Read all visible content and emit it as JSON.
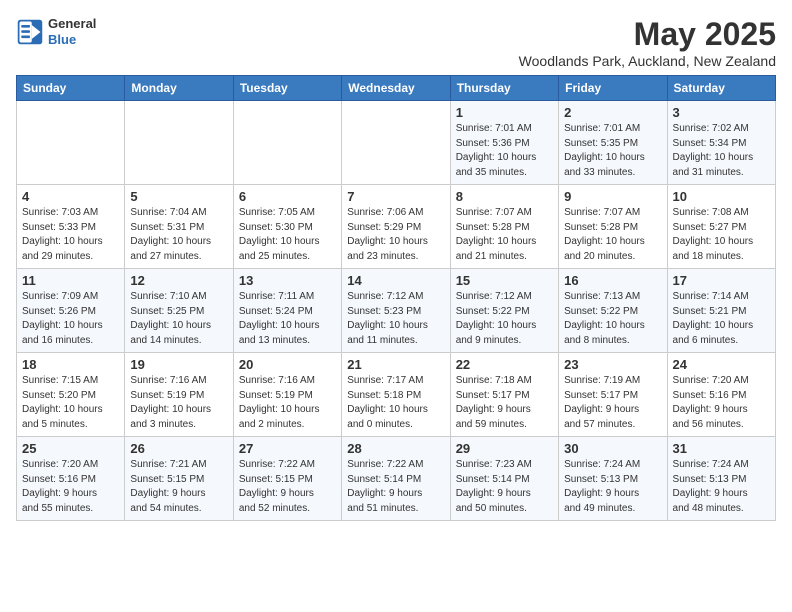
{
  "logo": {
    "line1": "General",
    "line2": "Blue"
  },
  "title": "May 2025",
  "subtitle": "Woodlands Park, Auckland, New Zealand",
  "days_of_week": [
    "Sunday",
    "Monday",
    "Tuesday",
    "Wednesday",
    "Thursday",
    "Friday",
    "Saturday"
  ],
  "weeks": [
    [
      {
        "num": "",
        "info": ""
      },
      {
        "num": "",
        "info": ""
      },
      {
        "num": "",
        "info": ""
      },
      {
        "num": "",
        "info": ""
      },
      {
        "num": "1",
        "info": "Sunrise: 7:01 AM\nSunset: 5:36 PM\nDaylight: 10 hours\nand 35 minutes."
      },
      {
        "num": "2",
        "info": "Sunrise: 7:01 AM\nSunset: 5:35 PM\nDaylight: 10 hours\nand 33 minutes."
      },
      {
        "num": "3",
        "info": "Sunrise: 7:02 AM\nSunset: 5:34 PM\nDaylight: 10 hours\nand 31 minutes."
      }
    ],
    [
      {
        "num": "4",
        "info": "Sunrise: 7:03 AM\nSunset: 5:33 PM\nDaylight: 10 hours\nand 29 minutes."
      },
      {
        "num": "5",
        "info": "Sunrise: 7:04 AM\nSunset: 5:31 PM\nDaylight: 10 hours\nand 27 minutes."
      },
      {
        "num": "6",
        "info": "Sunrise: 7:05 AM\nSunset: 5:30 PM\nDaylight: 10 hours\nand 25 minutes."
      },
      {
        "num": "7",
        "info": "Sunrise: 7:06 AM\nSunset: 5:29 PM\nDaylight: 10 hours\nand 23 minutes."
      },
      {
        "num": "8",
        "info": "Sunrise: 7:07 AM\nSunset: 5:28 PM\nDaylight: 10 hours\nand 21 minutes."
      },
      {
        "num": "9",
        "info": "Sunrise: 7:07 AM\nSunset: 5:28 PM\nDaylight: 10 hours\nand 20 minutes."
      },
      {
        "num": "10",
        "info": "Sunrise: 7:08 AM\nSunset: 5:27 PM\nDaylight: 10 hours\nand 18 minutes."
      }
    ],
    [
      {
        "num": "11",
        "info": "Sunrise: 7:09 AM\nSunset: 5:26 PM\nDaylight: 10 hours\nand 16 minutes."
      },
      {
        "num": "12",
        "info": "Sunrise: 7:10 AM\nSunset: 5:25 PM\nDaylight: 10 hours\nand 14 minutes."
      },
      {
        "num": "13",
        "info": "Sunrise: 7:11 AM\nSunset: 5:24 PM\nDaylight: 10 hours\nand 13 minutes."
      },
      {
        "num": "14",
        "info": "Sunrise: 7:12 AM\nSunset: 5:23 PM\nDaylight: 10 hours\nand 11 minutes."
      },
      {
        "num": "15",
        "info": "Sunrise: 7:12 AM\nSunset: 5:22 PM\nDaylight: 10 hours\nand 9 minutes."
      },
      {
        "num": "16",
        "info": "Sunrise: 7:13 AM\nSunset: 5:22 PM\nDaylight: 10 hours\nand 8 minutes."
      },
      {
        "num": "17",
        "info": "Sunrise: 7:14 AM\nSunset: 5:21 PM\nDaylight: 10 hours\nand 6 minutes."
      }
    ],
    [
      {
        "num": "18",
        "info": "Sunrise: 7:15 AM\nSunset: 5:20 PM\nDaylight: 10 hours\nand 5 minutes."
      },
      {
        "num": "19",
        "info": "Sunrise: 7:16 AM\nSunset: 5:19 PM\nDaylight: 10 hours\nand 3 minutes."
      },
      {
        "num": "20",
        "info": "Sunrise: 7:16 AM\nSunset: 5:19 PM\nDaylight: 10 hours\nand 2 minutes."
      },
      {
        "num": "21",
        "info": "Sunrise: 7:17 AM\nSunset: 5:18 PM\nDaylight: 10 hours\nand 0 minutes."
      },
      {
        "num": "22",
        "info": "Sunrise: 7:18 AM\nSunset: 5:17 PM\nDaylight: 9 hours\nand 59 minutes."
      },
      {
        "num": "23",
        "info": "Sunrise: 7:19 AM\nSunset: 5:17 PM\nDaylight: 9 hours\nand 57 minutes."
      },
      {
        "num": "24",
        "info": "Sunrise: 7:20 AM\nSunset: 5:16 PM\nDaylight: 9 hours\nand 56 minutes."
      }
    ],
    [
      {
        "num": "25",
        "info": "Sunrise: 7:20 AM\nSunset: 5:16 PM\nDaylight: 9 hours\nand 55 minutes."
      },
      {
        "num": "26",
        "info": "Sunrise: 7:21 AM\nSunset: 5:15 PM\nDaylight: 9 hours\nand 54 minutes."
      },
      {
        "num": "27",
        "info": "Sunrise: 7:22 AM\nSunset: 5:15 PM\nDaylight: 9 hours\nand 52 minutes."
      },
      {
        "num": "28",
        "info": "Sunrise: 7:22 AM\nSunset: 5:14 PM\nDaylight: 9 hours\nand 51 minutes."
      },
      {
        "num": "29",
        "info": "Sunrise: 7:23 AM\nSunset: 5:14 PM\nDaylight: 9 hours\nand 50 minutes."
      },
      {
        "num": "30",
        "info": "Sunrise: 7:24 AM\nSunset: 5:13 PM\nDaylight: 9 hours\nand 49 minutes."
      },
      {
        "num": "31",
        "info": "Sunrise: 7:24 AM\nSunset: 5:13 PM\nDaylight: 9 hours\nand 48 minutes."
      }
    ]
  ]
}
